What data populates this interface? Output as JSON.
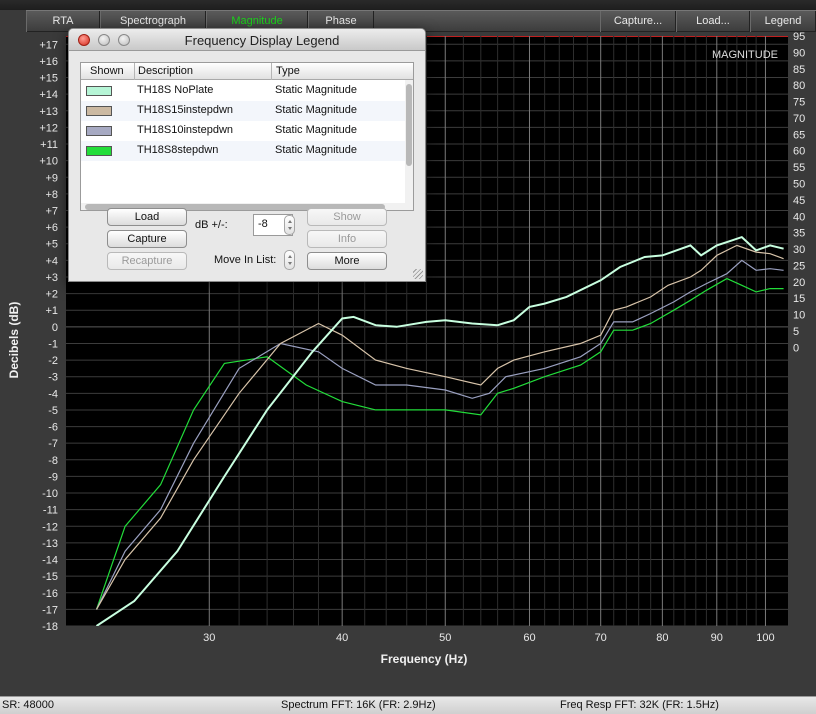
{
  "tabs": {
    "rta": "RTA",
    "spectrograph": "Spectrograph",
    "magnitude": "Magnitude",
    "phase": "Phase",
    "capture": "Capture...",
    "load": "Load...",
    "legend": "Legend"
  },
  "colors": {
    "active_tab": "#1bd31b",
    "plot_bg": "#000000",
    "grid": "#4a4a4a"
  },
  "chart_data": {
    "type": "line",
    "title": "MAGNITUDE",
    "xlabel": "Frequency (Hz)",
    "ylabel": "Decibels (dB)",
    "x_ticks": [
      "30",
      "40",
      "50",
      "60",
      "70",
      "80",
      "90",
      "100"
    ],
    "x_tick_values": [
      30,
      40,
      50,
      60,
      70,
      80,
      90,
      100
    ],
    "xlim": [
      22,
      105
    ],
    "x_scale": "log",
    "ylim": [
      -18,
      17.5
    ],
    "y_ticks": [
      17,
      16,
      15,
      14,
      13,
      12,
      11,
      10,
      9,
      8,
      7,
      6,
      5,
      4,
      3,
      2,
      1,
      0,
      -1,
      -2,
      -3,
      -4,
      -5,
      -6,
      -7,
      -8,
      -9,
      -10,
      -11,
      -12,
      -13,
      -14,
      -15,
      -16,
      -17,
      -18
    ],
    "y_tick_labels": [
      "+17",
      "+16",
      "+15",
      "+14",
      "+13",
      "+12",
      "+11",
      "+10",
      "+9",
      "+8",
      "+7",
      "+6",
      "+5",
      "+4",
      "+3",
      "+2",
      "+1",
      "0",
      "-1",
      "-2",
      "-3",
      "-4",
      "-5",
      "-6",
      "-7",
      "-8",
      "-9",
      "-10",
      "-11",
      "-12",
      "-13",
      "-14",
      "-15",
      "-16",
      "-17",
      "-18"
    ],
    "right_axis_ticks": [
      "95",
      "90",
      "85",
      "80",
      "75",
      "70",
      "65",
      "60",
      "55",
      "50",
      "45",
      "40",
      "35",
      "30",
      "25",
      "20",
      "15",
      "10",
      "5",
      "0"
    ],
    "right_axis_values": [
      95,
      90,
      85,
      80,
      75,
      70,
      65,
      60,
      55,
      50,
      45,
      40,
      35,
      30,
      25,
      20,
      15,
      10,
      5,
      0
    ],
    "right_axis_range": [
      -85,
      95
    ],
    "grid": true,
    "series": [
      {
        "name": "TH18S NoPlate",
        "color": "#c8ffe0",
        "x": [
          23.5,
          25.5,
          28,
          31,
          34,
          37.5,
          40,
          41,
          43,
          45,
          48,
          50,
          53,
          56,
          58,
          60,
          62,
          65,
          70,
          73,
          77,
          80,
          85,
          87,
          90,
          93,
          95,
          98,
          101,
          104
        ],
        "y": [
          -18,
          -16.5,
          -13.5,
          -9,
          -5,
          -1.5,
          0.5,
          0.6,
          0.1,
          0.0,
          0.3,
          0.4,
          0.2,
          0.1,
          0.4,
          1.2,
          1.4,
          1.8,
          2.8,
          3.6,
          4.2,
          4.3,
          4.9,
          4.3,
          4.9,
          5.2,
          5.4,
          4.6,
          4.9,
          4.7
        ]
      },
      {
        "name": "TH18S15instepdwn",
        "color": "#d8c4aa",
        "x": [
          23.5,
          25,
          27,
          29,
          32,
          35,
          38,
          40,
          43,
          46,
          50,
          54,
          56,
          58,
          62,
          67,
          70,
          72,
          74,
          78,
          81,
          85,
          87,
          90,
          94,
          98,
          101,
          104
        ],
        "y": [
          -17,
          -14,
          -11.5,
          -8,
          -4,
          -1,
          0.2,
          -0.5,
          -2,
          -2.5,
          -3.0,
          -3.5,
          -2.5,
          -2.0,
          -1.5,
          -1.0,
          -0.5,
          1.0,
          1.2,
          1.8,
          2.5,
          3.0,
          3.4,
          4.3,
          4.9,
          4.5,
          4.4,
          4.1
        ]
      },
      {
        "name": "TH18S10instepdwn",
        "color": "#9aa0c0",
        "x": [
          23.5,
          25,
          27,
          29,
          32,
          35,
          38,
          40,
          43,
          46,
          50,
          53,
          55,
          57,
          62,
          67,
          70,
          72,
          75,
          78,
          82,
          85,
          88,
          92,
          95,
          98,
          101,
          104
        ],
        "y": [
          -17,
          -13.5,
          -11,
          -7,
          -2.5,
          -1,
          -1.5,
          -2.5,
          -3.5,
          -3.5,
          -3.8,
          -4.3,
          -4.0,
          -3.0,
          -2.5,
          -1.8,
          -1.0,
          0.3,
          0.3,
          0.8,
          1.5,
          2.1,
          2.6,
          3.2,
          4.0,
          3.4,
          3.5,
          3.4
        ]
      },
      {
        "name": "TH18S8stepdwn",
        "color": "#22dd3a",
        "x": [
          23.5,
          25,
          27,
          29,
          31,
          34,
          37,
          40,
          43,
          46,
          50,
          54,
          56,
          58,
          62,
          67,
          70,
          72,
          75,
          78,
          82,
          85,
          88,
          92,
          95,
          98,
          101,
          104
        ],
        "y": [
          -17,
          -12,
          -9.5,
          -5,
          -2.2,
          -1.8,
          -3.5,
          -4.5,
          -5.0,
          -5.0,
          -5.0,
          -5.3,
          -4.0,
          -3.7,
          -3.0,
          -2.3,
          -1.5,
          -0.2,
          -0.2,
          0.2,
          1.0,
          1.6,
          2.2,
          2.9,
          2.5,
          2.1,
          2.3,
          2.3
        ]
      },
      {
        "name": "",
        "color": "#b89e60",
        "x": [],
        "y": []
      }
    ]
  },
  "legend_window": {
    "title": "Frequency Display Legend",
    "columns": {
      "shown": "Shown",
      "description": "Description",
      "type": "Type"
    },
    "rows": [
      {
        "color": "#b6f5d6",
        "description": "TH18S NoPlate",
        "type": "Static Magnitude"
      },
      {
        "color": "#cbb9a2",
        "description": "TH18S15instepdwn",
        "type": "Static Magnitude"
      },
      {
        "color": "#a6a9c2",
        "description": "TH18S10instepdwn",
        "type": "Static Magnitude"
      },
      {
        "color": "#22dd3a",
        "description": "TH18S8stepdwn",
        "type": "Static Magnitude"
      }
    ],
    "buttons": {
      "load": "Load",
      "capture": "Capture",
      "recapture": "Recapture",
      "show": "Show",
      "info": "Info",
      "more": "More"
    },
    "db_label": "dB +/-:",
    "db_value": "-8",
    "move_label": "Move In List:"
  },
  "status": {
    "sr": "SR: 48000",
    "spectrum_fft": "Spectrum FFT: 16K (FR: 2.9Hz)",
    "freq_resp_fft": "Freq Resp FFT: 32K (FR: 1.5Hz)"
  }
}
